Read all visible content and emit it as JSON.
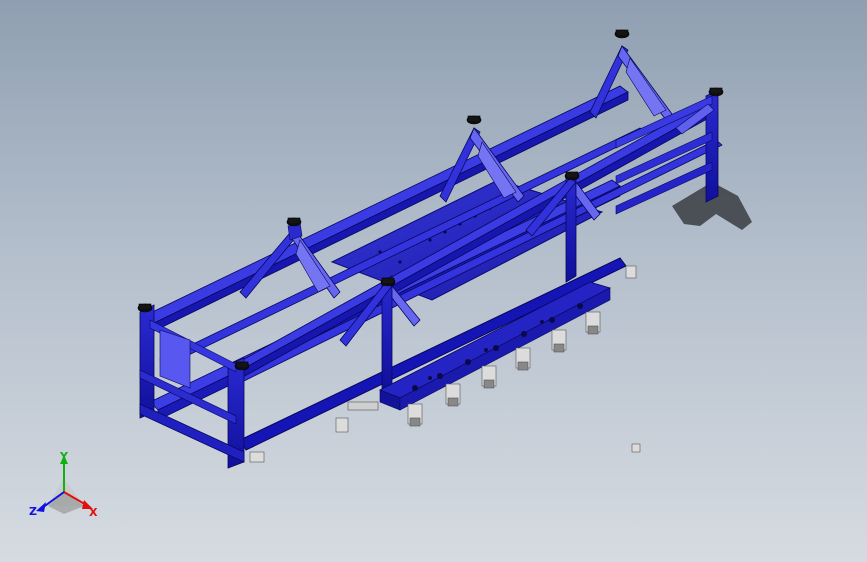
{
  "viewport": {
    "background_top": "#8f9fb1",
    "background_bottom": "#d6dbe1"
  },
  "model": {
    "frame_color": "#1f1fd0",
    "frame_dark": "#0d0d8a",
    "frame_light": "#5e5ef0",
    "plate_color": "#2828c8",
    "shadow_color": "#3c3f46",
    "cylinder_color": "#d9d9d9",
    "foot_color": "#111111"
  },
  "triad": {
    "x_label": "X",
    "y_label": "Y",
    "z_label": "Z",
    "x_color": "#e01010",
    "y_color": "#10b010",
    "z_color": "#1010e0"
  }
}
